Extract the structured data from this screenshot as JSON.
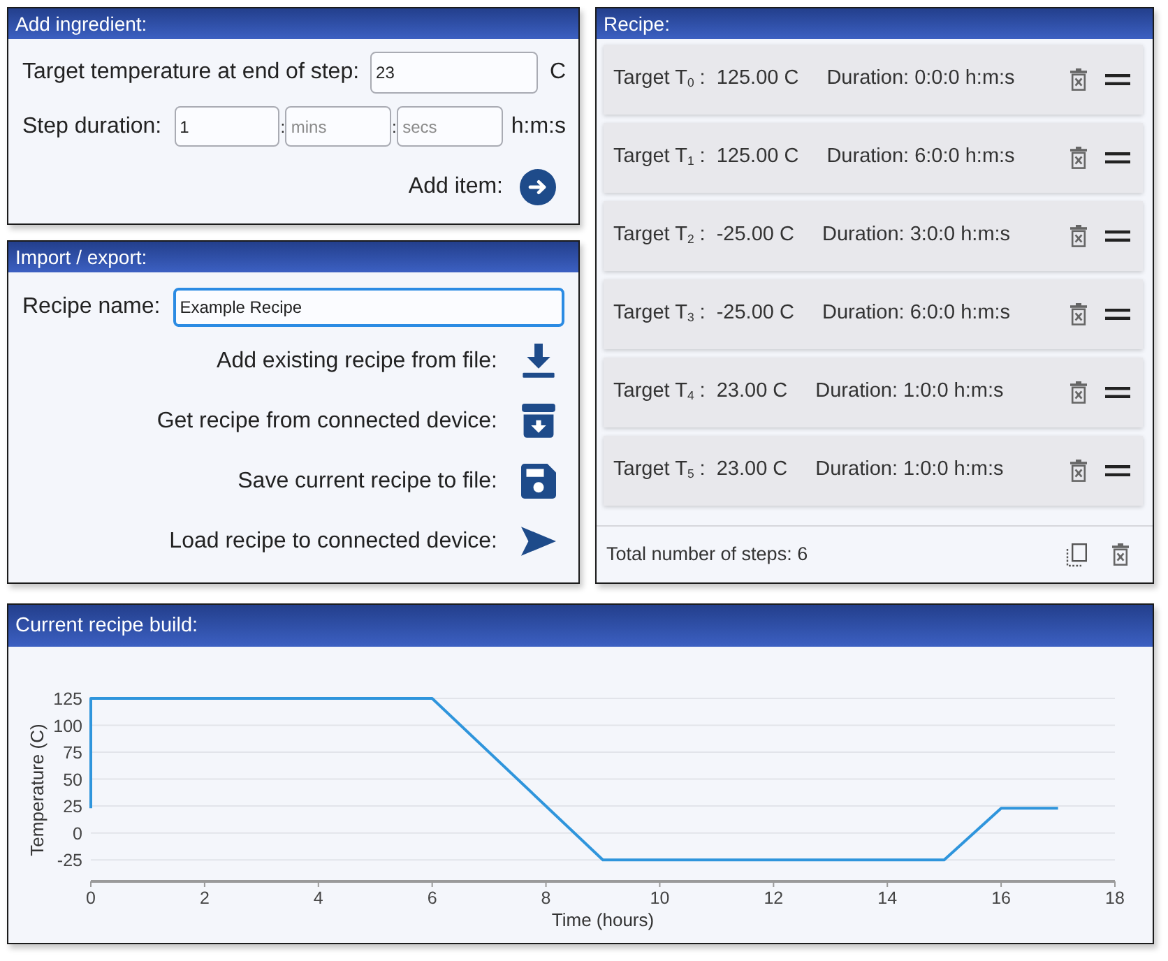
{
  "add_ingredient": {
    "title": "Add ingredient:",
    "temperature": {
      "label": "Target temperature at end of step:",
      "value": "23",
      "unit": "C"
    },
    "duration": {
      "label": "Step duration:",
      "fields": [
        {
          "value": "1"
        },
        {
          "separator": ":",
          "placeholder": "mins"
        },
        {
          "separator": ":",
          "placeholder": "secs"
        }
      ],
      "unit": "h:m:s"
    },
    "add_button": {
      "label": "Add item:"
    }
  },
  "import_export": {
    "title": "Import / export:",
    "recipe_name": {
      "label": "Recipe name:",
      "value": "Example Recipe",
      "focused": true
    },
    "actions": [
      {
        "kind": "download",
        "label": "Add existing recipe from file:"
      },
      {
        "kind": "archive",
        "label": "Get recipe from connected device:"
      },
      {
        "kind": "save",
        "label": "Save current recipe to file:"
      },
      {
        "kind": "send",
        "label": "Load recipe to connected device:"
      }
    ]
  },
  "recipe": {
    "title": "Recipe:",
    "steps": [
      {
        "label": "Target T$_{0}$ :",
        "temperature": "125.00 C",
        "duration": "Duration: 0:0:0 h:m:s"
      },
      {
        "label": "Target T$_{1}$ :",
        "temperature": "125.00 C",
        "duration": "Duration: 6:0:0 h:m:s"
      },
      {
        "label": "Target T$_{2}$ :",
        "temperature": "-25.00 C",
        "duration": "Duration: 3:0:0 h:m:s"
      },
      {
        "label": "Target T$_{3}$ :",
        "temperature": "-25.00 C",
        "duration": "Duration: 6:0:0 h:m:s"
      },
      {
        "label": "Target T$_{4}$ :",
        "temperature": "23.00 C",
        "duration": "Duration: 1:0:0 h:m:s"
      },
      {
        "label": "Target T$_{5}$ :",
        "temperature": "23.00 C",
        "duration": "Duration: 1:0:0 h:m:s"
      }
    ],
    "footer": {
      "text": "Total number of steps: 6"
    }
  },
  "recipe_build": {
    "title": "Current recipe build:",
    "chart_data": {
      "type": "line",
      "xlabel": "Time (hours)",
      "ylabel": "Temperature (C)",
      "x": [
        0,
        0,
        6,
        9,
        15,
        16,
        17
      ],
      "series": [
        {
          "color": "#2f95dc",
          "values": [
            23,
            125,
            125,
            -25,
            -25,
            23,
            23
          ]
        }
      ],
      "xlim": [
        0,
        18
      ],
      "ylim": [
        -45,
        125
      ],
      "xticks": [
        0,
        2,
        4,
        6,
        8,
        10,
        12,
        14,
        16,
        18
      ],
      "yticks": [
        -25,
        0,
        25,
        50,
        75,
        100,
        125
      ],
      "grid": true
    }
  }
}
